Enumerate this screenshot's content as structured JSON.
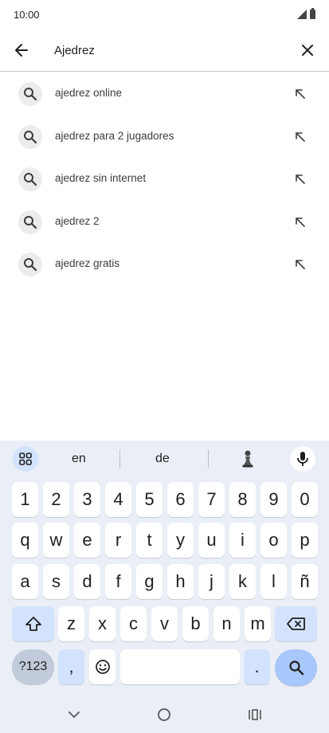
{
  "status_bar": {
    "time": "10:00"
  },
  "search": {
    "value": "Ajedrez"
  },
  "suggestions": [
    {
      "text": "ajedrez online"
    },
    {
      "text": "ajedrez para 2 jugadores"
    },
    {
      "text": "ajedrez sin internet"
    },
    {
      "text": "ajedrez 2"
    },
    {
      "text": "ajedrez gratis"
    }
  ],
  "keyboard": {
    "suggestions": [
      "en",
      "de"
    ],
    "row_numbers": [
      "1",
      "2",
      "3",
      "4",
      "5",
      "6",
      "7",
      "8",
      "9",
      "0"
    ],
    "row1": [
      "q",
      "w",
      "e",
      "r",
      "t",
      "y",
      "u",
      "i",
      "o",
      "p"
    ],
    "row2": [
      "a",
      "s",
      "d",
      "f",
      "g",
      "h",
      "j",
      "k",
      "l",
      "ñ"
    ],
    "row3": [
      "z",
      "x",
      "c",
      "v",
      "b",
      "n",
      "m"
    ],
    "symbols_label": "?123",
    "comma": ",",
    "period": "."
  },
  "colors": {
    "accent": "#a8c7fa",
    "modifier": "#d3e3fd",
    "keyboard_bg": "#eaeef6"
  },
  "icons": [
    "back-arrow-icon",
    "close-icon",
    "search-icon",
    "arrow-up-left-icon",
    "grid-icon",
    "chess-pawn-icon",
    "mic-icon",
    "shift-icon",
    "backspace-icon",
    "emoji-icon",
    "nav-back-icon",
    "nav-home-icon",
    "nav-recents-icon"
  ]
}
